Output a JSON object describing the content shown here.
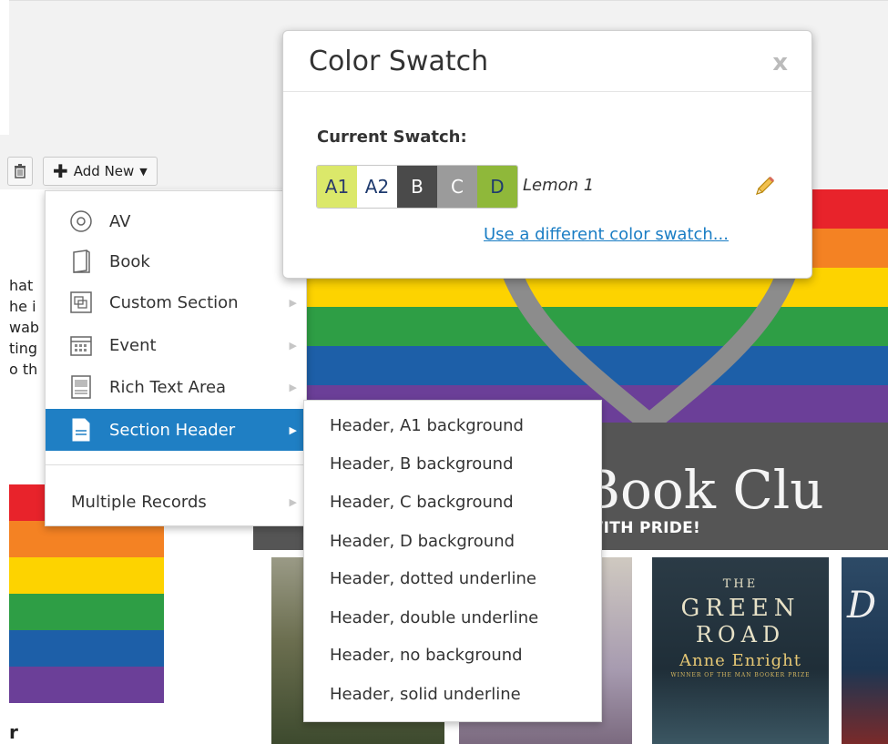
{
  "toolbar": {
    "add_new_label": "Add New"
  },
  "left_page": {
    "text_lines": [
      "hat",
      "he i",
      "wab",
      "ting",
      "o th"
    ],
    "heading": "r"
  },
  "banner": {
    "stripe_colors": [
      "#e8232b",
      "#f48223",
      "#fdd300",
      "#2e9e45",
      "#1d5fa8",
      "#6b3f98"
    ],
    "title": "A Book Clu",
    "subtitle": "D WITH PRIDE!"
  },
  "covers": {
    "cover3": {
      "line1": "THE",
      "line2": "GREEN",
      "line3": "ROAD",
      "author": "Anne Enright",
      "tagline": "WINNER OF THE MAN BOOKER PRIZE"
    },
    "cover4": {
      "letter": "D"
    }
  },
  "menu": {
    "items": [
      {
        "label": "AV",
        "icon": "disc-icon",
        "has_submenu": false
      },
      {
        "label": "Book",
        "icon": "book-icon",
        "has_submenu": false
      },
      {
        "label": "Custom Section",
        "icon": "custom-section-icon",
        "has_submenu": true
      },
      {
        "label": "Event",
        "icon": "calendar-icon",
        "has_submenu": true
      },
      {
        "label": "Rich Text Area",
        "icon": "rich-text-icon",
        "has_submenu": true
      },
      {
        "label": "Section Header",
        "icon": "document-icon",
        "has_submenu": true,
        "active": true
      },
      {
        "label": "Multiple Records",
        "icon": "",
        "has_submenu": true
      }
    ]
  },
  "submenu": {
    "items": [
      "Header, A1 background",
      "Header, B background",
      "Header, C background",
      "Header, D background",
      "Header, dotted underline",
      "Header, double underline",
      "Header, no background",
      "Header, solid underline"
    ]
  },
  "dialog": {
    "title": "Color Swatch",
    "close": "x",
    "current_label": "Current Swatch:",
    "swatch": [
      {
        "label": "A1",
        "bg": "#dbe86a",
        "fg": "#2b3a6b"
      },
      {
        "label": "A2",
        "bg": "#ffffff",
        "fg": "#1f3b6e"
      },
      {
        "label": "B",
        "bg": "#4a4a4a",
        "fg": "#ffffff"
      },
      {
        "label": "C",
        "bg": "#9b9b9b",
        "fg": "#ffffff"
      },
      {
        "label": "D",
        "bg": "#8fb83a",
        "fg": "#1f3b6e"
      }
    ],
    "swatch_name": "Lemon 1",
    "change_link": "Use a different color swatch..."
  }
}
